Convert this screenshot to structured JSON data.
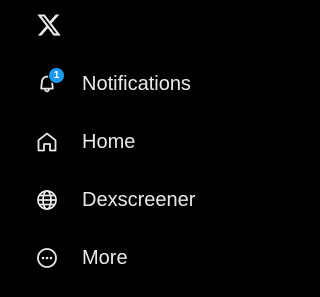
{
  "app": {
    "logo_icon": "x-logo-icon"
  },
  "colors": {
    "background": "#000000",
    "text": "#e7e9ea",
    "badge": "#1d9bf0"
  },
  "nav": {
    "items": [
      {
        "label": "Notifications",
        "icon": "bell-icon",
        "badge": "1"
      },
      {
        "label": "Home",
        "icon": "home-icon"
      },
      {
        "label": "Dexscreener",
        "icon": "globe-icon"
      },
      {
        "label": "More",
        "icon": "more-circle-icon"
      }
    ]
  }
}
